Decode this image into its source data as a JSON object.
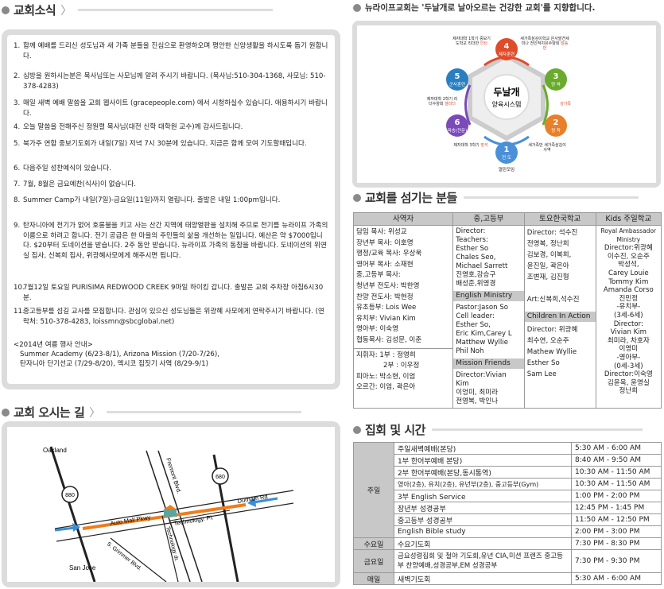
{
  "news": {
    "title": "교회소식",
    "items": [
      {
        "num": "1.",
        "text": "함께 예배를 드리신 성도님과 새 가족 분들을 진심으로 환영하오며 평안한 신앙생활을 하시도록 돕기 원합니다."
      },
      {
        "num": "2.",
        "text": "심방을 원하시는분은 목사님또는 사모님께 알려 주시기 바랍니다. (목사님:510-304-1368, 사모님: 510-378-4283)"
      },
      {
        "num": "3.",
        "text": "매일 새벽 예배 말씀을 교회 웹사이트 (gracepeople.com) 에서 시청하실수 있습니다. 애용하시기 바랍니다."
      },
      {
        "num": "4.",
        "text": "오늘 말씀을 전해주신 정원렬 목사님(대전 신학 대학원 교수)께 감사드립니다."
      },
      {
        "num": "5.",
        "text": "북가주 연합 중보기도회가 내일(7일) 저녁 7시 30분에 있습니다. 지금은 함께 모여 기도할때입니다."
      },
      {
        "num": "6.",
        "text": "다음주일 성찬예식이 있습니다."
      },
      {
        "num": "7.",
        "text": "7월, 8월은 금요예찬(식사)이 없습니다."
      },
      {
        "num": "8.",
        "text": "Summer Camp가 내일(7일)-금요일(11일)까지 열립니다. 출발은 내일 1:00pm입니다."
      },
      {
        "num": "9.",
        "text": "탄자니아에 전기가 없어 호롱불을 키고 사는 산간 지역에 태양열판을 설치해 주므로 전기를 뉴라이프 가족의 이름으로 하려고 합니다. 전기 공급은 한 마을의 주민들의 삶을 개선하는 일입니다. 예산은 약 $7000입니다. $20부터 도네이션을 받습니다. 2주 동안 받습니다. 뉴라이프 가족의 동참을 바랍니다. 도네이션의 위연실 집사, 신복희 집사, 위광혜사모에게 해주시면 됩니다."
      },
      {
        "num": "10.",
        "text": "7월12일 토요일 PURISIMA REDWOOD CREEK 9마일 하이킹 갑니다. 출발은 교회 주차장 아침6시30분."
      },
      {
        "num": "11.",
        "text": "중고등부를 섬길 교사를 모집합니다. 관심이 있으신 성도님들은 위광혜 사모에게 연락주시기 바랍니다. (연락처: 510-378-4283, loissmn@sbcglobal.net)"
      }
    ],
    "summer_title": "<2014년 여름 행사 안내>",
    "summer_line1": "Summer Academy (6/23-8/1), Arizona Mission (7/20-7/26),",
    "summer_line2": "탄자니아 단기선교 (7/29-8/20), 멕시코 집짓기 사역 (8/29-9/1)"
  },
  "directions": {
    "title": "교회 오시는 길",
    "labels": {
      "oakland": "Oakland",
      "san_jose": "San Jose",
      "fremont": "Fremont Blvd.",
      "auto_mall": "Auto Mall Pkwy",
      "durham": "Durham Rd",
      "technology_dr": "Technology dr.",
      "technology_pl": "Technology. Pl.",
      "grimmer": "S. Grimmer Blvd.",
      "hwy880": "880",
      "hwy680": "680"
    }
  },
  "vision": {
    "text": "뉴라이프교회는 '두날개로 날아오르는 건강한 교회'를 지향합니다.",
    "center_title": "두날개",
    "center_sub": "양육시스템",
    "nodes": [
      {
        "num": "1",
        "label": "전 도",
        "color": "#4a90d9"
      },
      {
        "num": "2",
        "label": "정 착",
        "color": "#e8802a"
      },
      {
        "num": "3",
        "label": "양 육",
        "color": "#6aab2e"
      },
      {
        "num": "4",
        "label": "제자훈련",
        "color": "#e04b2a"
      },
      {
        "num": "5",
        "label": "군사훈련",
        "color": "#2a7fc1"
      },
      {
        "num": "6",
        "label": "파송(전문)",
        "color": "#7a4ab8"
      }
    ],
    "notes": {
      "top_left": "제자대학 1학기 중보기도학교 리더반",
      "top_left_red": "인턴",
      "top_right": "새가족삼김이학교 은사발견세미나 전인적치유수양회",
      "top_right_red": "말씀반",
      "left": "제자대학 2학기 리더수양회",
      "left_red": "셀리더",
      "right_red": "성가족",
      "bottom_left": "제자대학 3학기",
      "bottom_left_red": "방석",
      "bottom_right": "새가족반 새가족삼김이사역",
      "bottom": "열린모임"
    }
  },
  "staff": {
    "title": "교회를 섬기는 분들",
    "headers": [
      "사역자",
      "중,고등부",
      "토요한국학교",
      "Kids 주일학교"
    ],
    "col1": [
      "담임 목사: 위성교",
      "장년부 목사: 이호명",
      "행정/교육 목사: 우상욱",
      "영어부 목사: 소재현",
      "중,고등부 목사:",
      "청년부 전도사: 박한영",
      "찬양 전도사: 박현정",
      "유초등부: Lois Wee",
      "유치부: Vivian Kim",
      "영아부: 이숙영",
      "협동목사: 김성문, 이춘"
    ],
    "col1_b": [
      "지휘자: 1부 : 정영희",
      "2부 : 이우정",
      "피아노: 박소현, 이엄",
      "오르간: 이엄, 곽은아"
    ],
    "col2": [
      "Director:",
      "Teachers:",
      "Esther So",
      "Chales Seo,",
      "Michael Sarrett",
      "진영호,강승구",
      "배성준,위영경"
    ],
    "col2_h2": "English Ministry",
    "col2_b": [
      "Pastor:Jason So",
      "Cell leader:",
      "Esther So,",
      "Eric Kim,Carey L",
      "Matthew Wyllie",
      "Phil Noh"
    ],
    "col2_h3": "Mission Friends",
    "col2_c": [
      "Director:Vivian Kim",
      "이엉미, 최미라",
      "전영복, 박인나"
    ],
    "col3": [
      "Director: 석수진",
      "전영복, 정난희",
      "김보경, 이복희,",
      "윤진일, 곽은아",
      "조변재, 김진형"
    ],
    "col3_art": "Art:신복희,석수진",
    "col3_h2": "Children In Action",
    "col3_b": [
      "Director: 위광혜",
      "최수연, 오순주",
      "Mathew Wyllie",
      "Esther So",
      "Sam Lee"
    ],
    "col4": [
      "Royal Ambassador",
      "Ministry",
      "Director:위광혜",
      "이수진, 오순주",
      "박성석,",
      "Carey Louie",
      "Tommy Kim",
      "Amanda Corso",
      "진민정",
      "-유치부-",
      "(3세-6세)",
      "Director:",
      "Vivian Kim",
      "최미라, 차호자",
      "이영미",
      "-영아부-",
      "(0세-3세)",
      "Director:이숙영",
      "김윤옥, 윤영실",
      "정난희"
    ]
  },
  "schedule": {
    "title": "집회 및 시간",
    "groups": [
      {
        "day": "주일",
        "rows": [
          {
            "name": "주일새벽예배(본당)",
            "time": "5:30 AM - 6:00 AM"
          },
          {
            "name": "1부 한어부예배 본당)",
            "time": "8:40 AM - 9:50 AM"
          },
          {
            "name": "2부 한어부예배(본당,동시통역)",
            "time": "10:30 AM - 11:50 AM"
          },
          {
            "name": "영아(2층), 유치(2층), 유년부(2층), 중고등부(Gym)",
            "time": "10:30 AM - 11:50 AM"
          },
          {
            "name": "3부 English Service",
            "time": "1:00 PM - 2:00 PM"
          },
          {
            "name": "장년부 성경공부",
            "time": "12:45 PM - 1:45 PM"
          },
          {
            "name": "중고등부 성경공부",
            "time": "11:50 AM - 12:50 PM"
          },
          {
            "name": "English Bible study",
            "time": "2:00 PM - 3:00 PM"
          }
        ]
      },
      {
        "day": "수요일",
        "rows": [
          {
            "name": "수요기도회",
            "time": "7:30 PM - 8:30 PM"
          }
        ]
      },
      {
        "day": "금요일",
        "rows": [
          {
            "name": "금요성령집회 및 철야 기도회,유년 CIA,미션 프렌즈 중고등부 찬양예배,성경공부,EM 성경공부",
            "time": "7:30 PM - 9:30 PM"
          }
        ]
      },
      {
        "day": "매일",
        "rows": [
          {
            "name": "새벽기도회",
            "time": "5:30 AM - 6:00 AM"
          }
        ]
      }
    ]
  }
}
